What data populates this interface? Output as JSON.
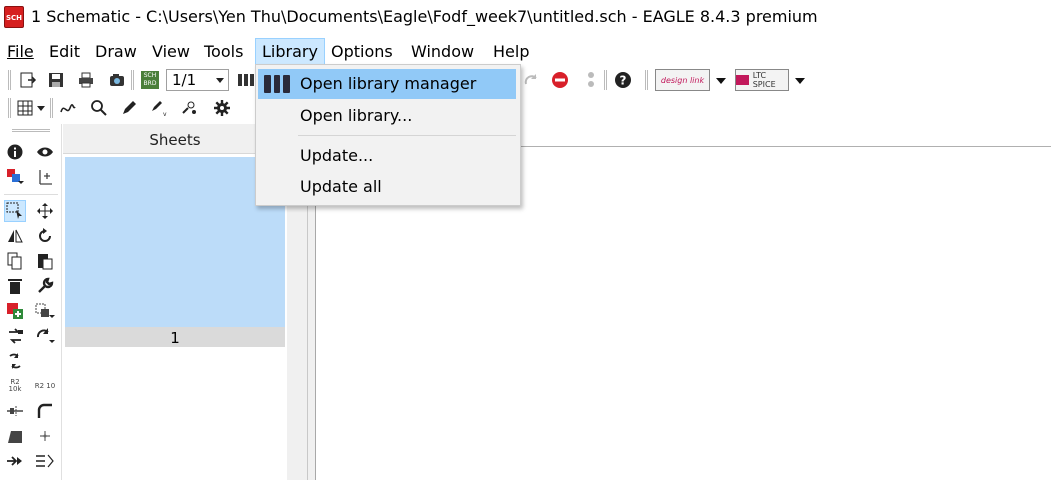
{
  "window": {
    "icon_text": "SCH",
    "title": "1 Schematic - C:\\Users\\Yen Thu\\Documents\\Eagle\\Fodf_week7\\untitled.sch - EAGLE 8.4.3 premium"
  },
  "menubar": {
    "items": [
      {
        "label": "File"
      },
      {
        "label": "Edit"
      },
      {
        "label": "Draw"
      },
      {
        "label": "View"
      },
      {
        "label": "Tools"
      },
      {
        "label": "Library"
      },
      {
        "label": "Options"
      },
      {
        "label": "Window"
      },
      {
        "label": "Help"
      }
    ],
    "active": "Library"
  },
  "toolbar": {
    "sheet_value": "1/1",
    "sch_brd_label": "SCH BRD",
    "design_link_label": "design link",
    "ltspice_label": "LTC SPICE"
  },
  "library_menu": {
    "items": [
      {
        "label": "Open library manager",
        "icon": "library-books-icon",
        "highlighted": true
      },
      {
        "label": "Open library...",
        "highlighted": false
      },
      {
        "label": "Update...",
        "highlighted": false
      },
      {
        "label": "Update all",
        "highlighted": false
      }
    ]
  },
  "sheets_panel": {
    "header": "Sheets",
    "sheets": [
      {
        "number": "1"
      }
    ]
  },
  "commands": {
    "small_labels": [
      "R2 10k",
      "R2 10"
    ]
  },
  "colors": {
    "menu_highlight": "#91c9f7",
    "active_menu": "#cce8ff",
    "sheet_thumb": "#bcdcf9",
    "stop_red": "#d8202a"
  }
}
